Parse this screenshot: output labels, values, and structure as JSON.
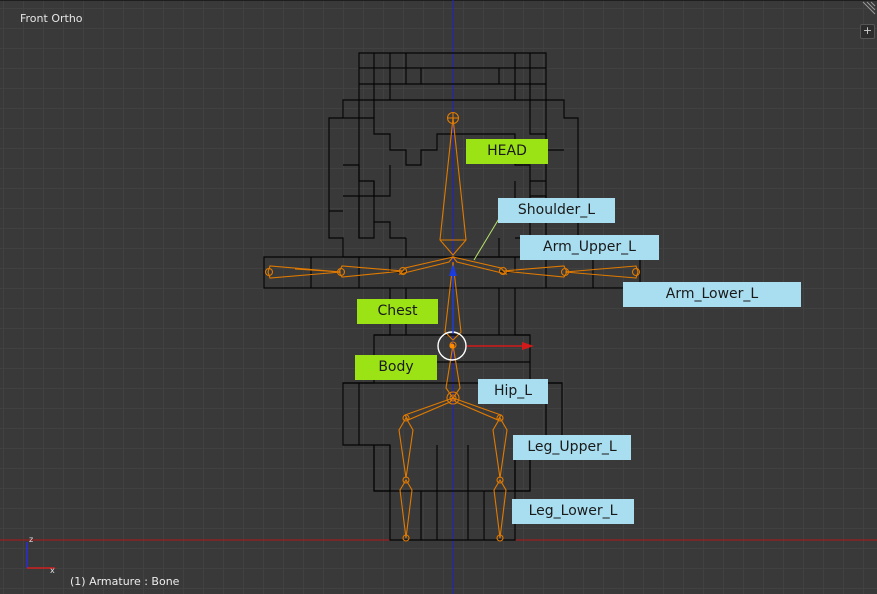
{
  "viewport": {
    "view_name": "Front Ortho",
    "status": "(1) Armature : Bone",
    "colors": {
      "background": "#393939",
      "bone": "#e07a00",
      "mesh": "#050505",
      "axis_z": "#1a1ad0",
      "axis_x": "#c01818",
      "label_green": "#9be315",
      "label_blue": "#a9def0"
    },
    "mini_axis": {
      "z_label": "z",
      "x_label": "x"
    },
    "corner_icon": "plus-icon"
  },
  "bones": {
    "head": "HEAD",
    "shoulder": "Shoulder_L",
    "arm_upper": "Arm_Upper_L",
    "arm_lower": "Arm_Lower_L",
    "chest": "Chest",
    "body": "Body",
    "hip": "Hip_L",
    "leg_upper": "Leg_Upper_L",
    "leg_lower": "Leg_Lower_L"
  }
}
